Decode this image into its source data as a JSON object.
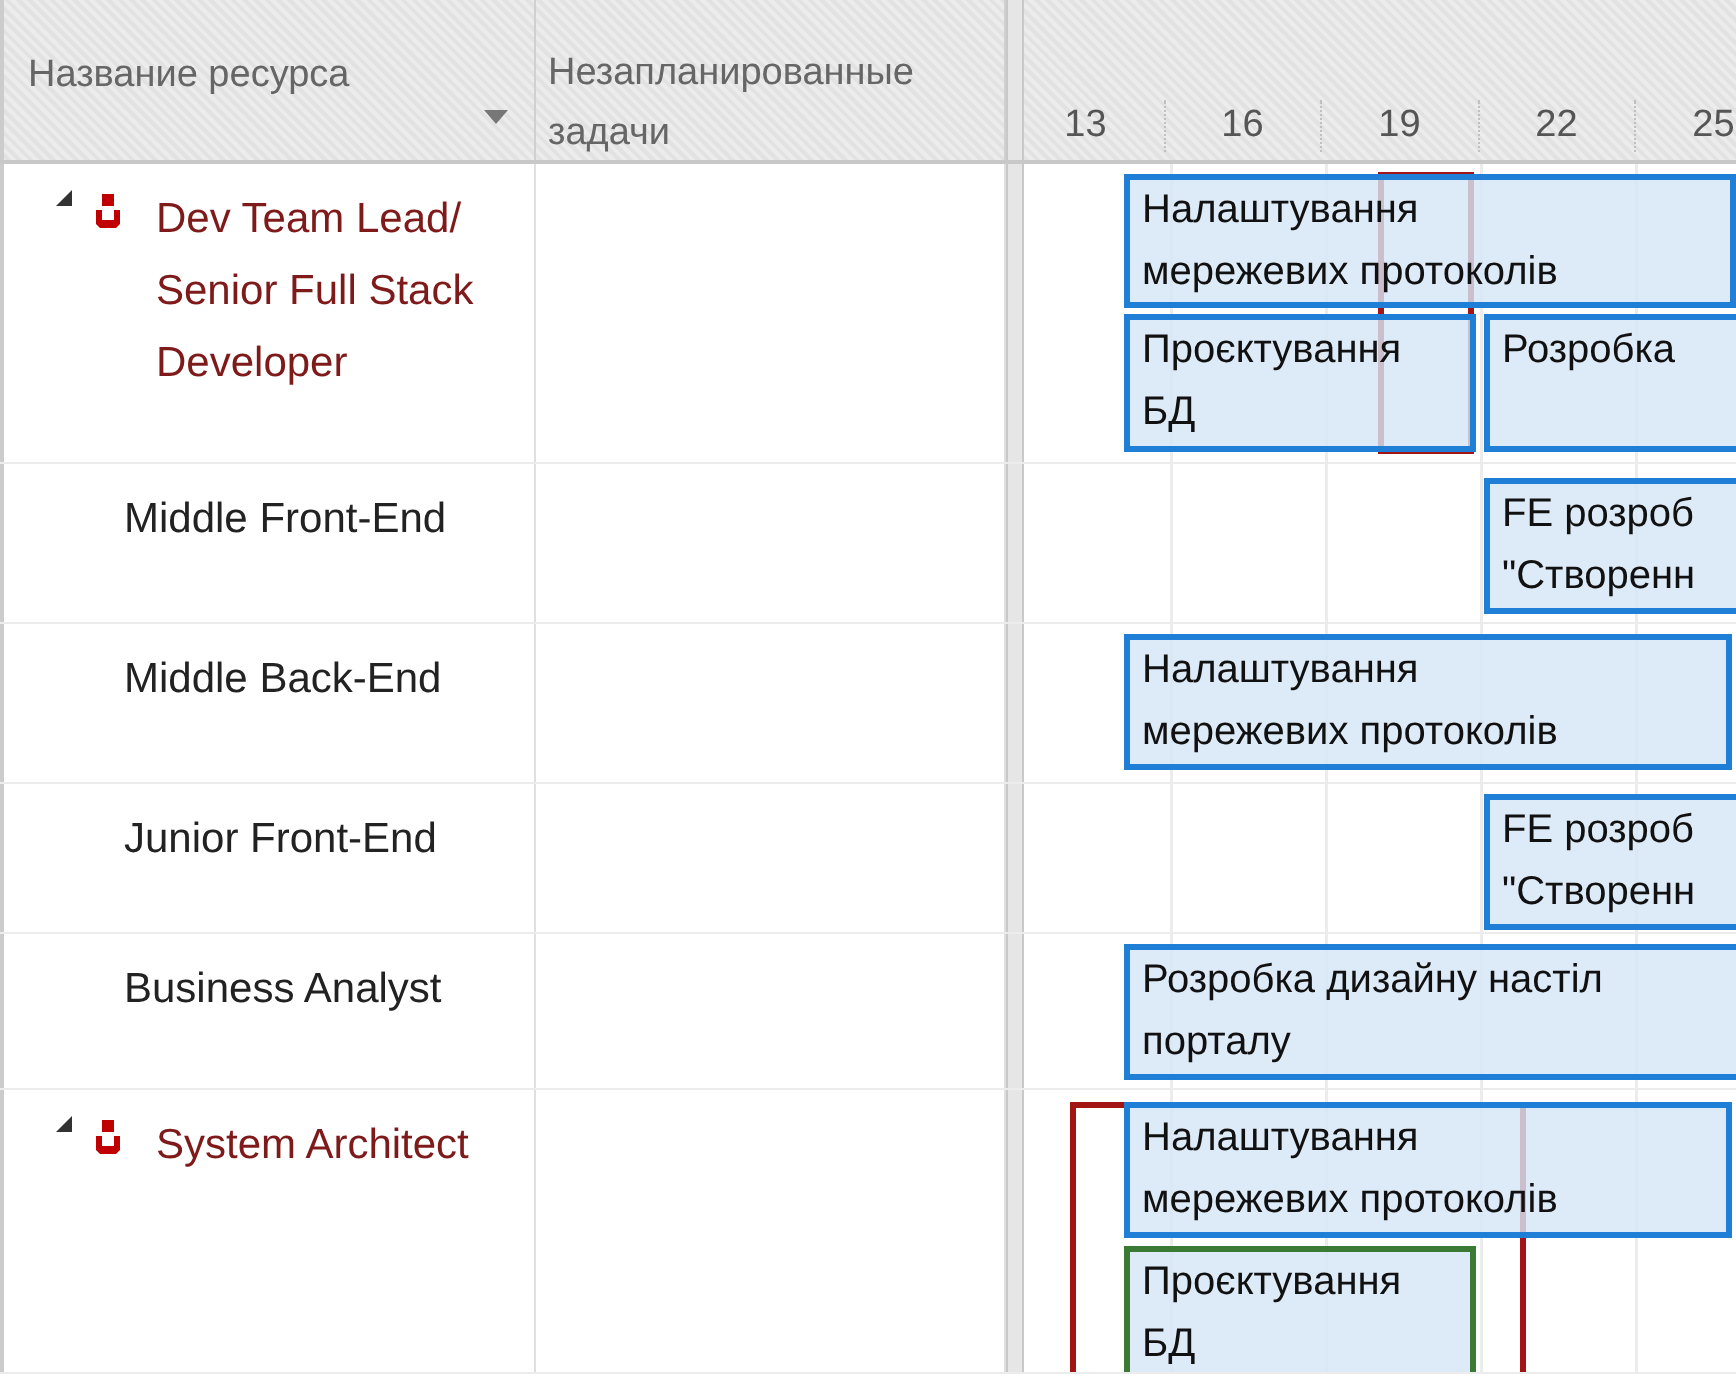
{
  "columns": [
    "Название ресурса",
    "Незапланированные задачи"
  ],
  "timeline": {
    "ticks": [
      "13",
      "16",
      "19",
      "22",
      "25"
    ]
  },
  "resources": [
    {
      "kind": "group",
      "name": "Dev Team Lead/ Senior Full Stack Developer",
      "expanded": true,
      "overallocated": true,
      "tasks": [
        {
          "label": "Налаштування\nмережевих протоколів",
          "color": "#1f7ed6"
        },
        {
          "label": "Проєктування\nБД",
          "color": "#1f7ed6"
        },
        {
          "label": "Розробка",
          "color": "#1f7ed6"
        }
      ]
    },
    {
      "kind": "member",
      "name": "Middle Front-End",
      "overallocated": false,
      "tasks": [
        {
          "label": "FE розроб\n\"Створенн",
          "color": "#1f7ed6"
        }
      ]
    },
    {
      "kind": "member",
      "name": "Middle Back-End",
      "overallocated": false,
      "tasks": [
        {
          "label": "Налаштування\nмережевих протоколів",
          "color": "#1f7ed6"
        }
      ]
    },
    {
      "kind": "member",
      "name": "Junior Front-End",
      "overallocated": false,
      "tasks": [
        {
          "label": "FE розроб\n\"Створенн",
          "color": "#1f7ed6"
        }
      ]
    },
    {
      "kind": "member",
      "name": "Business Analyst",
      "overallocated": false,
      "tasks": [
        {
          "label": "Розробка дизайну настіл\nпорталу",
          "color": "#1f7ed6"
        }
      ]
    },
    {
      "kind": "group",
      "name": "System Architect",
      "expanded": true,
      "overallocated": true,
      "tasks": [
        {
          "label": "Налаштування\nмережевих протоколів",
          "color": "#1f7ed6"
        },
        {
          "label": "Проєктування\nБД",
          "color": "#3a7a34"
        }
      ]
    }
  ]
}
